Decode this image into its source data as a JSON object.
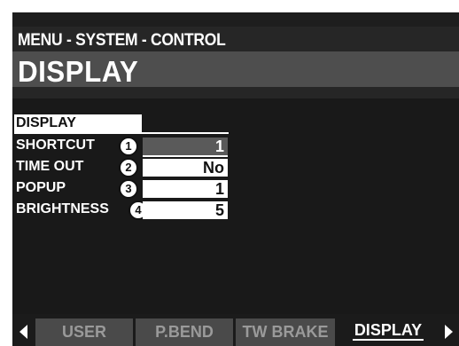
{
  "header": {
    "breadcrumb": "MENU - SYSTEM - CONTROL",
    "title": "DISPLAY"
  },
  "section": {
    "label": "DISPLAY"
  },
  "parameters": [
    {
      "number": "1",
      "label": "SHORTCUT",
      "value": "1",
      "selected": true
    },
    {
      "number": "2",
      "label": "TIME OUT",
      "value": "No",
      "selected": false
    },
    {
      "number": "3",
      "label": "POPUP",
      "value": "1",
      "selected": false
    },
    {
      "number": "4",
      "label": "BRIGHTNESS",
      "value": "5",
      "selected": false
    }
  ],
  "tabs": [
    {
      "label": "USER",
      "active": false
    },
    {
      "label": "P.BEND",
      "active": false
    },
    {
      "label": "TW BRAKE",
      "active": false
    },
    {
      "label": "DISPLAY",
      "active": true
    }
  ],
  "icons": {
    "left": "triangle-left-icon",
    "right": "triangle-right-icon"
  }
}
